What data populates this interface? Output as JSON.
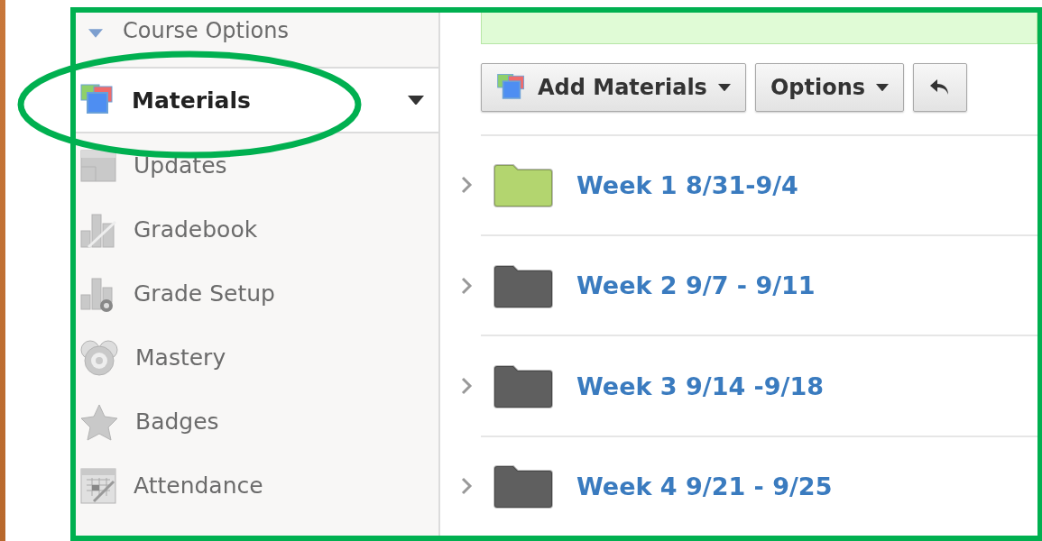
{
  "sidebar": {
    "header": {
      "label": "Course Options",
      "expanded": true
    },
    "items": [
      {
        "label": "Materials",
        "selected": true
      },
      {
        "label": "Updates",
        "selected": false
      },
      {
        "label": "Gradebook",
        "selected": false
      },
      {
        "label": "Grade Setup",
        "selected": false
      },
      {
        "label": "Mastery",
        "selected": false
      },
      {
        "label": "Badges",
        "selected": false
      },
      {
        "label": "Attendance",
        "selected": false
      }
    ]
  },
  "toolbar": {
    "buttons": [
      {
        "kind": "dropdown",
        "label": "Add Materials",
        "icon": true
      },
      {
        "kind": "dropdown",
        "label": "Options",
        "icon": false
      },
      {
        "kind": "undo"
      }
    ]
  },
  "folders": [
    {
      "label": "Week 1 8/31-9/4",
      "color": "#b3d56f",
      "expanded": false
    },
    {
      "label": "Week 2 9/7 - 9/11",
      "color": "#5f5f5f",
      "expanded": false
    },
    {
      "label": "Week 3 9/14 -9/18",
      "color": "#5f5f5f",
      "expanded": false
    },
    {
      "label": "Week 4 9/21 - 9/25",
      "color": "#5f5f5f",
      "expanded": false
    }
  ]
}
